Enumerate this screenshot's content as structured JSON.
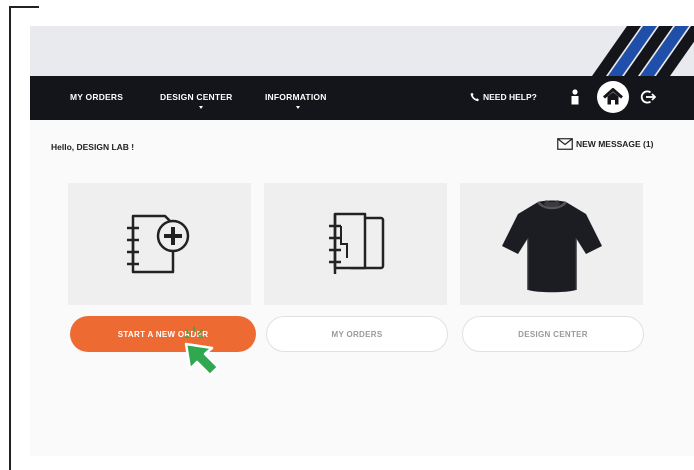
{
  "nav": {
    "items": [
      {
        "label": "MY ORDERS"
      },
      {
        "label": "DESIGN CENTER"
      },
      {
        "label": "INFORMATION"
      }
    ],
    "help_label": "NEED HELP?"
  },
  "greeting": "Hello, DESIGN LAB !",
  "message_label": "NEW MESSAGE (1)",
  "cards": [
    {
      "icon": "add-order-icon",
      "button_label": "START A NEW ORDER",
      "style": "primary"
    },
    {
      "icon": "orders-icon",
      "button_label": "MY ORDERS",
      "style": "outline"
    },
    {
      "icon": "jersey-icon",
      "button_label": "DESIGN CENTER",
      "style": "outline"
    }
  ],
  "colors": {
    "accent": "#ee6a33",
    "nav_bg": "#14151a",
    "stripe_blue": "#1f4fa8",
    "cursor_green": "#2fa84f"
  }
}
